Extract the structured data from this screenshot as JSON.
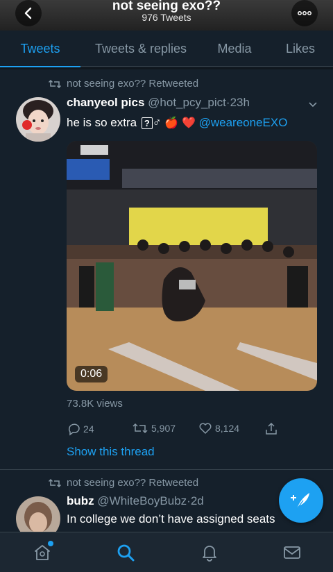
{
  "header": {
    "title": "not seeing exo??",
    "subtitle": "976 Tweets",
    "back_icon": "chevron-left-icon",
    "more_icon": "ellipsis-icon"
  },
  "tabs": [
    {
      "label": "Tweets",
      "active": true
    },
    {
      "label": "Tweets & replies",
      "active": false
    },
    {
      "label": "Media",
      "active": false
    },
    {
      "label": "Likes",
      "active": false
    }
  ],
  "tweets": [
    {
      "retweet_label": "not seeing exo?? Retweeted",
      "name": "chanyeol pics",
      "handle": "@hot_pcy_pict",
      "dot": "·",
      "time": "23h",
      "text_prefix": "he is so extra",
      "text_glyph": "?",
      "text_symbol": "♂",
      "emoji_apple": "🍎",
      "emoji_heart": "❤️",
      "mention": "@weareoneEXO",
      "video_duration": "0:06",
      "views": "73.8K views",
      "replies": "24",
      "retweets": "5,907",
      "likes": "8,124",
      "show_thread": "Show this thread"
    },
    {
      "retweet_label": "not seeing exo?? Retweeted",
      "name": "bubz",
      "handle": "@WhiteBoyBubz",
      "dot": "·",
      "time": "2d",
      "text": "In college we don’t have assigned seats"
    }
  ],
  "colors": {
    "background": "#15202b",
    "accent": "#1da1f2",
    "secondary_text": "#8899a6",
    "divider": "#38444d"
  },
  "bottom_nav": [
    {
      "icon": "home-icon",
      "active": false,
      "has_dot": true
    },
    {
      "icon": "search-icon",
      "active": true
    },
    {
      "icon": "bell-icon",
      "active": false
    },
    {
      "icon": "mail-icon",
      "active": false
    }
  ],
  "fab_icon": "compose-feather-icon"
}
